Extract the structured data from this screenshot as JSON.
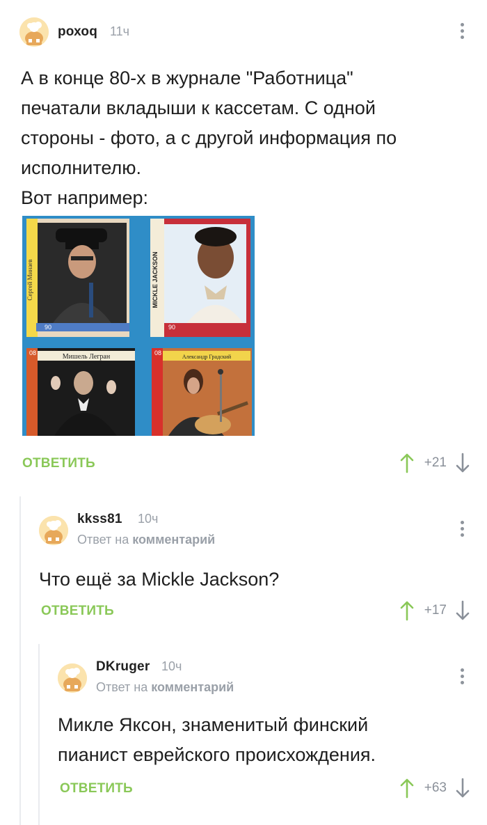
{
  "comments": [
    {
      "username": "рохоq",
      "time": "11ч",
      "body_lines": [
        "А в конце 80-х в журнале \"Работница\"",
        "печатали вкладыши к кассетам. С одной",
        "стороны - фото, а с другой информация по",
        "исполнителю.",
        "Вот например:"
      ],
      "reply_label": "ОТВЕТИТЬ",
      "score": "+21"
    },
    {
      "username": "kkss81",
      "time": "10ч",
      "reply_prefix": "Ответ на",
      "reply_target": "комментарий",
      "body_lines": [
        "Что ещё за Mickle Jackson?"
      ],
      "reply_label": "ОТВЕТИТЬ",
      "score": "+17"
    },
    {
      "username": "DKruger",
      "time": "10ч",
      "reply_prefix": "Ответ на",
      "reply_target": "комментарий",
      "body_lines": [
        "Микле Яксон, знаменитый финский",
        "пианист еврейского происхождения."
      ],
      "reply_label": "ОТВЕТИТЬ",
      "score": "+63"
    }
  ],
  "image": {
    "cards": [
      {
        "name": "Сергей Минаев",
        "number": "90"
      },
      {
        "name": "MICKLE JACKSON",
        "number": "90"
      },
      {
        "name": "Мишель Легран",
        "number": "08"
      },
      {
        "name": "Александр Градский",
        "number": "08"
      }
    ]
  },
  "colors": {
    "accent_green": "#8ac858",
    "meta_gray": "#9aa0a8",
    "collage_blue": "#2f8dc7"
  },
  "icons": {
    "more": "vertical-dots-icon",
    "vote_up": "arrow-up-icon",
    "vote_down": "arrow-down-icon",
    "avatar": "default-avatar-icon"
  }
}
